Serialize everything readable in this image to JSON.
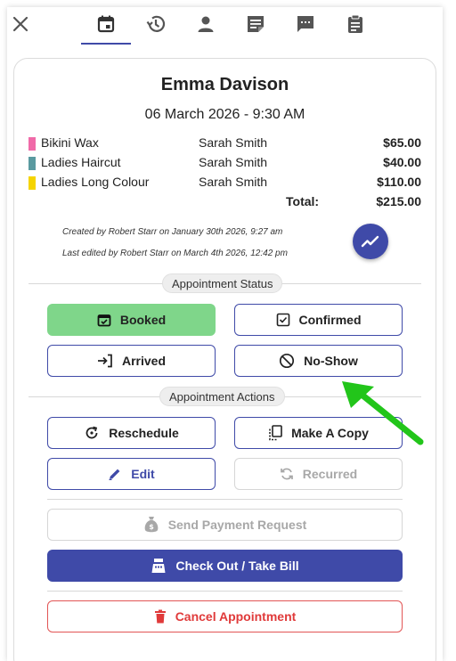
{
  "appointment": {
    "client_name": "Emma Davison",
    "datetime": "06 March 2026 - 9:30 AM",
    "services": [
      {
        "name": "Bikini Wax",
        "staff": "Sarah Smith",
        "price": "$65.00",
        "color": "#f06aa8"
      },
      {
        "name": "Ladies Haircut",
        "staff": "Sarah Smith",
        "price": "$40.00",
        "color": "#5a9aa0"
      },
      {
        "name": "Ladies Long Colour",
        "staff": "Sarah Smith",
        "price": "$110.00",
        "color": "#f5d400"
      }
    ],
    "total_label": "Total:",
    "total_value": "$215.00",
    "created_text": "Created by Robert Starr on January 30th 2026, 9:27 am",
    "edited_text": "Last edited by Robert Starr on March 4th 2026, 12:42 pm"
  },
  "status_section": {
    "title": "Appointment Status",
    "buttons": {
      "booked": "Booked",
      "confirmed": "Confirmed",
      "arrived": "Arrived",
      "no_show": "No-Show"
    }
  },
  "actions_section": {
    "title": "Appointment Actions",
    "buttons": {
      "reschedule": "Reschedule",
      "make_copy": "Make A Copy",
      "edit": "Edit",
      "recurred": "Recurred",
      "send_payment": "Send Payment Request",
      "checkout": "Check Out / Take Bill",
      "cancel": "Cancel Appointment"
    }
  },
  "colors": {
    "accent": "#3f4aa8",
    "booked": "#7fd68a",
    "danger": "#e03a3a",
    "arrow": "#22c51a"
  },
  "icons": {
    "tabs": [
      "calendar-icon",
      "history-icon",
      "person-icon",
      "note-icon",
      "chat-icon",
      "clipboard-icon"
    ],
    "close": "close-icon"
  }
}
